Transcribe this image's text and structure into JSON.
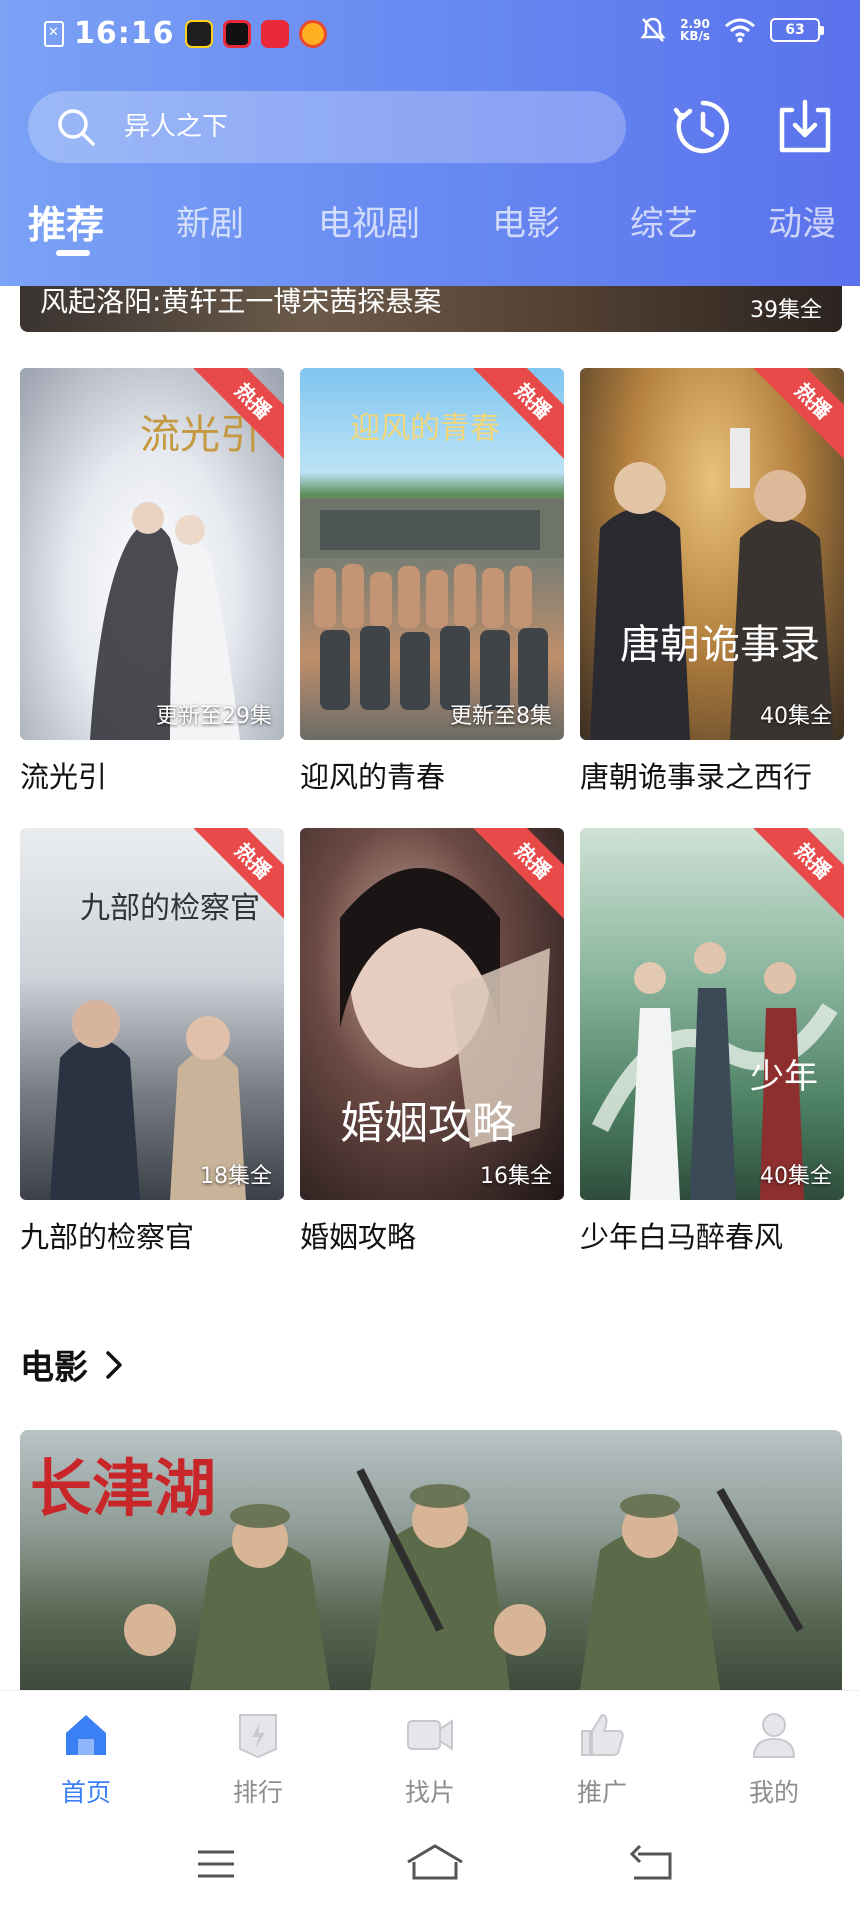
{
  "status_bar": {
    "time": "16:16",
    "net_speed_value": "2.90",
    "net_speed_unit": "KB/s",
    "battery": "63"
  },
  "search": {
    "placeholder": "异人之下"
  },
  "tabs": [
    {
      "label": "推荐",
      "active": true
    },
    {
      "label": "新剧",
      "active": false
    },
    {
      "label": "电视剧",
      "active": false
    },
    {
      "label": "电影",
      "active": false
    },
    {
      "label": "综艺",
      "active": false
    },
    {
      "label": "动漫",
      "active": false
    }
  ],
  "banner": {
    "title": "风起洛阳:黄轩王一博宋茜探悬案",
    "count": "39集全"
  },
  "grid": [
    {
      "title": "流光引",
      "badge": "热播",
      "count": "更新至29集"
    },
    {
      "title": "迎风的青春",
      "badge": "热播",
      "count": "更新至8集"
    },
    {
      "title": "唐朝诡事录之西行",
      "badge": "热播",
      "count": "40集全"
    },
    {
      "title": "九部的检察官",
      "badge": "热播",
      "count": "18集全"
    },
    {
      "title": "婚姻攻略",
      "badge": "热播",
      "count": "16集全"
    },
    {
      "title": "少年白马醉春风",
      "badge": "热播",
      "count": "40集全"
    }
  ],
  "movie_section": {
    "title": "电影"
  },
  "bottom_nav": [
    {
      "label": "首页",
      "icon": "home-icon",
      "active": true
    },
    {
      "label": "排行",
      "icon": "ranking-icon",
      "active": false
    },
    {
      "label": "找片",
      "icon": "video-camera-icon",
      "active": false
    },
    {
      "label": "推广",
      "icon": "thumbs-up-icon",
      "active": false
    },
    {
      "label": "我的",
      "icon": "person-icon",
      "active": false
    }
  ],
  "colors": {
    "header_start": "#7aa2f5",
    "header_end": "#5a72ec",
    "accent": "#3b7ff5",
    "hot_badge": "#e84a4a"
  }
}
